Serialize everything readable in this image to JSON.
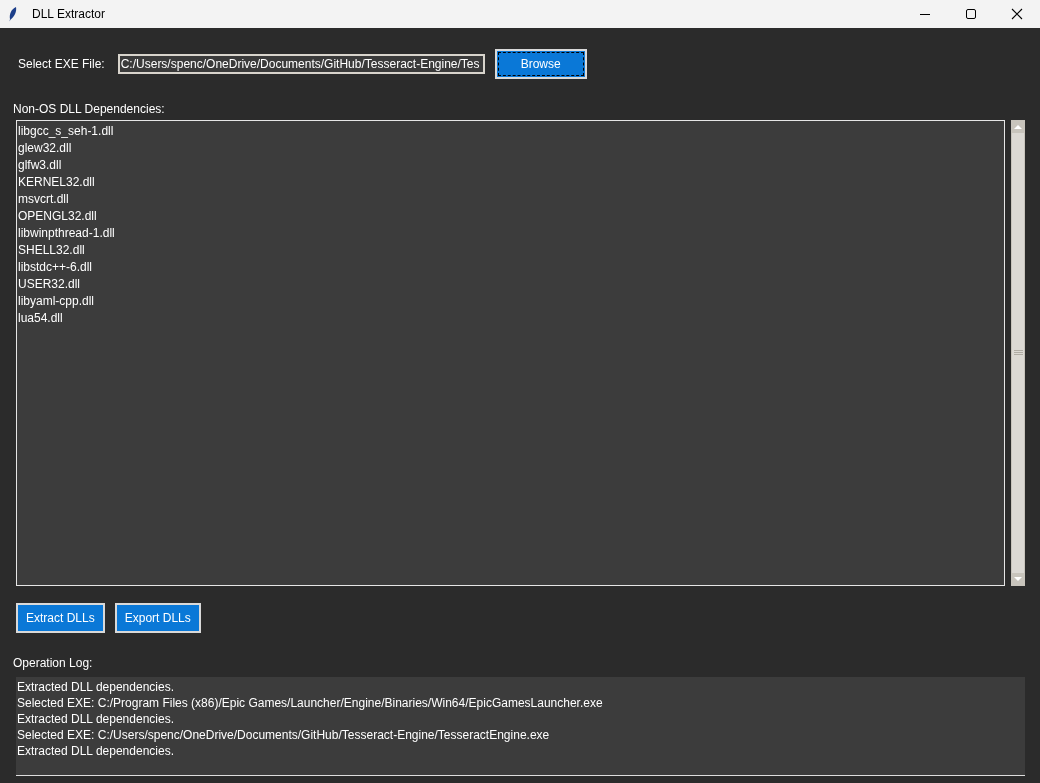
{
  "window": {
    "title": "DLL Extractor"
  },
  "exe": {
    "label": "Select EXE File:",
    "value": "C:/Users/spenc/OneDrive/Documents/GitHub/Tesseract-Engine/Tes",
    "browse": {
      "label": "Browse",
      "focused": true
    }
  },
  "dependencies": {
    "label": "Non-OS DLL Dependencies:",
    "items": [
      "libgcc_s_seh-1.dll",
      "glew32.dll",
      "glfw3.dll",
      "KERNEL32.dll",
      "msvcrt.dll",
      "OPENGL32.dll",
      "libwinpthread-1.dll",
      "SHELL32.dll",
      "libstdc++-6.dll",
      "USER32.dll",
      "libyaml-cpp.dll",
      "lua54.dll"
    ]
  },
  "buttons": [
    "Extract DLLs",
    "Export DLLs"
  ],
  "log": {
    "label": "Operation Log:",
    "lines": [
      "Extracted DLL dependencies.",
      "Selected EXE: C:/Program Files (x86)/Epic Games/Launcher/Engine/Binaries/Win64/EpicGamesLauncher.exe",
      "Extracted DLL dependencies.",
      "Selected EXE: C:/Users/spenc/OneDrive/Documents/GitHub/Tesseract-Engine/TesseractEngine.exe",
      "Extracted DLL dependencies."
    ]
  }
}
